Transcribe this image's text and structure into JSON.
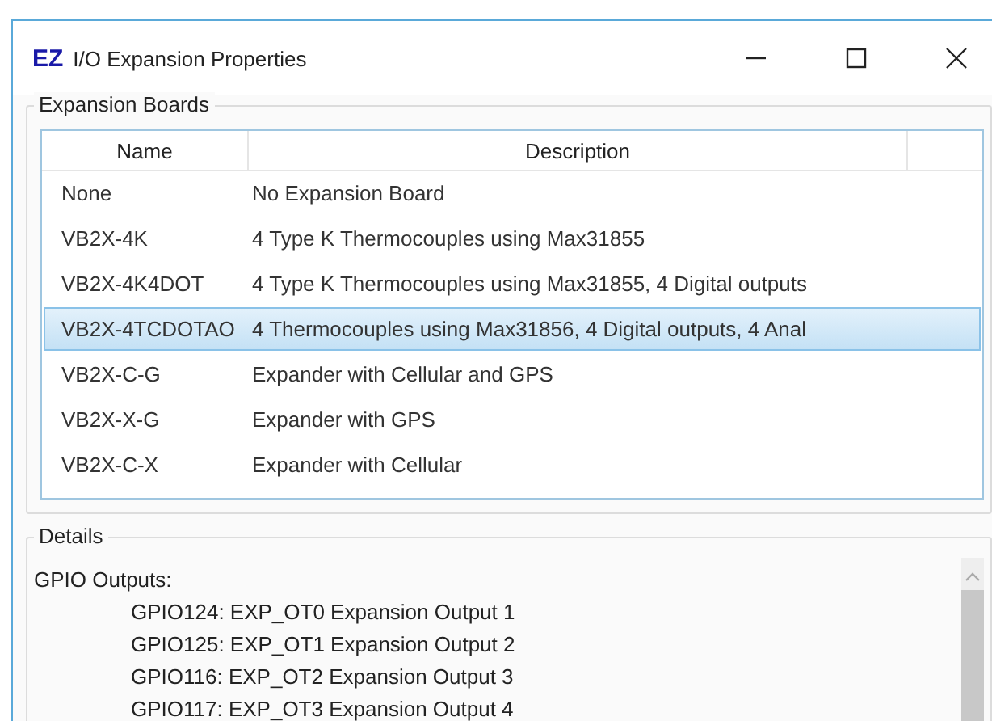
{
  "window": {
    "logo": "EZ",
    "title": "I/O Expansion Properties"
  },
  "boards_group": {
    "title": "Expansion Boards",
    "columns": [
      "Name",
      "Description"
    ],
    "rows": [
      {
        "name": "None",
        "description": "No Expansion Board",
        "selected": false
      },
      {
        "name": "VB2X-4K",
        "description": "4 Type K Thermocouples using Max31855",
        "selected": false
      },
      {
        "name": "VB2X-4K4DOT",
        "description": "4 Type K Thermocouples using Max31855, 4 Digital outputs",
        "selected": false
      },
      {
        "name": "VB2X-4TCDOTAO",
        "description": "4 Thermocouples using Max31856, 4 Digital outputs, 4 Anal",
        "selected": true
      },
      {
        "name": "VB2X-C-G",
        "description": "Expander with Cellular and GPS",
        "selected": false
      },
      {
        "name": "VB2X-X-G",
        "description": "Expander with GPS",
        "selected": false
      },
      {
        "name": "VB2X-C-X",
        "description": "Expander with Cellular",
        "selected": false
      }
    ]
  },
  "details_group": {
    "title": "Details",
    "heading": "GPIO Outputs:",
    "lines": [
      "GPIO124: EXP_OT0 Expansion Output 1",
      "GPIO125: EXP_OT1 Expansion Output 2",
      "GPIO116: EXP_OT2 Expansion Output 3",
      "GPIO117: EXP_OT3 Expansion Output 4"
    ]
  }
}
